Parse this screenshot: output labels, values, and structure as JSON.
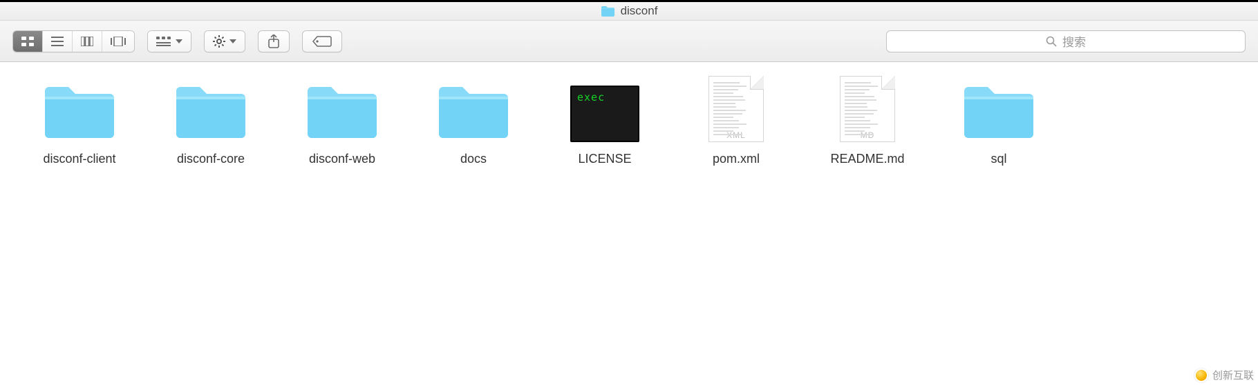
{
  "window": {
    "title": "disconf"
  },
  "toolbar": {
    "search_placeholder": "搜索"
  },
  "items": [
    {
      "name": "disconf-client",
      "kind": "folder"
    },
    {
      "name": "disconf-core",
      "kind": "folder"
    },
    {
      "name": "disconf-web",
      "kind": "folder"
    },
    {
      "name": "docs",
      "kind": "folder"
    },
    {
      "name": "LICENSE",
      "kind": "exec",
      "exec_label": "exec"
    },
    {
      "name": "pom.xml",
      "kind": "doc",
      "ext": "XML"
    },
    {
      "name": "README.md",
      "kind": "doc",
      "ext": "MD"
    },
    {
      "name": "sql",
      "kind": "folder"
    }
  ],
  "watermark": "创新互联"
}
